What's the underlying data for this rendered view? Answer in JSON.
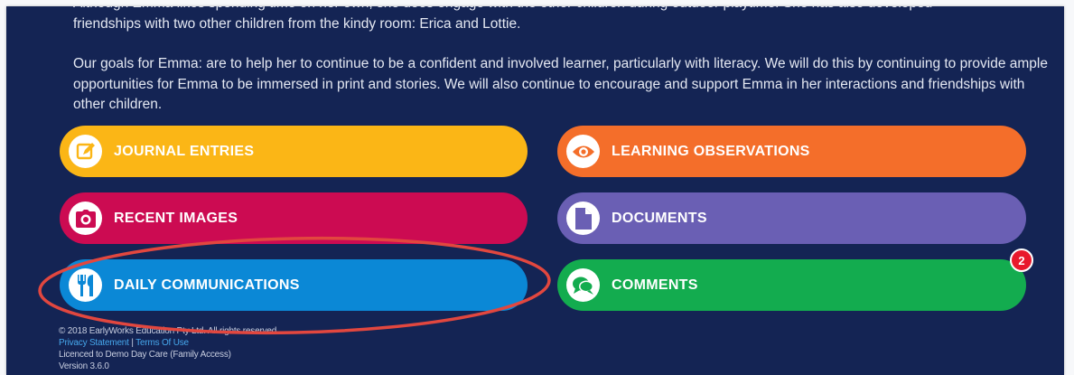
{
  "intro": {
    "partial_line": "Although Emma likes spending time on her own, she does engage with the other children during outdoor playtime. She has also developed",
    "para1_tail": "friendships with two other children from the kindy room: Erica and Lottie.",
    "para2": "Our goals for Emma: are to help her to continue to be a confident and involved learner, particularly with literacy. We will do this by continuing to provide ample opportunities for Emma to be immersed in print and stories. We will also continue to encourage and support Emma in her interactions and friendships with other children."
  },
  "tiles": {
    "journal": {
      "label": "JOURNAL ENTRIES",
      "icon": "edit-icon",
      "color": "#fbb616"
    },
    "learning": {
      "label": "LEARNING OBSERVATIONS",
      "icon": "eye-icon",
      "color": "#f46e2a"
    },
    "images": {
      "label": "RECENT IMAGES",
      "icon": "camera-icon",
      "color": "#cc0b52"
    },
    "documents": {
      "label": "DOCUMENTS",
      "icon": "document-icon",
      "color": "#6a5fb4"
    },
    "daily": {
      "label": "DAILY COMMUNICATIONS",
      "icon": "cutlery-icon",
      "color": "#0b88d6"
    },
    "comments": {
      "label": "COMMENTS",
      "icon": "chat-icon",
      "color": "#13ac4f",
      "badge": "2"
    }
  },
  "annotation": {
    "shape": "ellipse-highlight",
    "color": "#e2473f",
    "target": "DAILY COMMUNICATIONS"
  },
  "footer": {
    "copyright": "© 2018 EarlyWorks Education Pty Ltd. All rights reserved.",
    "privacy": "Privacy Statement",
    "separator": "|",
    "terms": "Terms Of Use",
    "licence": "Licenced to Demo Day Care (Family Access)",
    "version": "Version 3.6.0"
  },
  "colors": {
    "background": "#142454",
    "link": "#46a7ec"
  }
}
